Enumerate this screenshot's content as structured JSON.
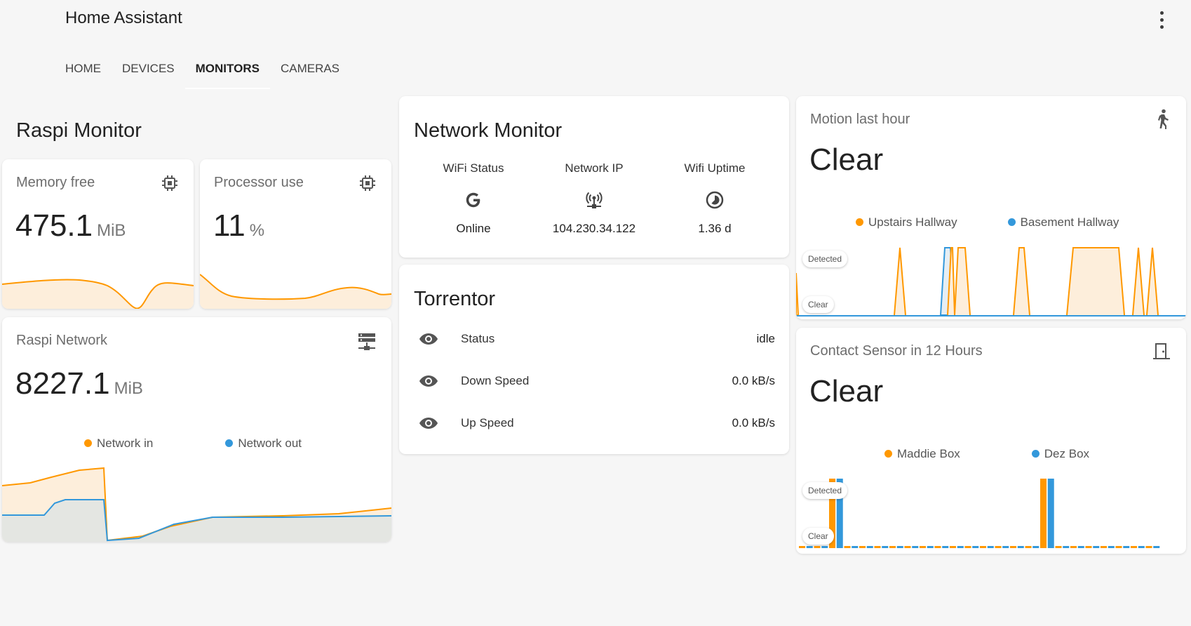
{
  "app": {
    "title": "Home Assistant"
  },
  "tabs": [
    {
      "label": "HOME"
    },
    {
      "label": "DEVICES"
    },
    {
      "label": "MONITORS"
    },
    {
      "label": "CAMERAS"
    }
  ],
  "raspi_monitor": {
    "title": "Raspi Monitor",
    "memory": {
      "name": "Memory free",
      "value": "475.1",
      "unit": "MiB",
      "icon": "chip-icon"
    },
    "processor": {
      "name": "Processor use",
      "value": "11",
      "unit": "%",
      "icon": "chip-icon"
    },
    "network": {
      "name": "Raspi Network",
      "value": "8227.1",
      "unit": "MiB",
      "icon": "server-network-icon",
      "legend": [
        "Network in",
        "Network out"
      ]
    }
  },
  "network_monitor": {
    "title": "Network Monitor",
    "columns": [
      {
        "label": "WiFi Status",
        "value": "Online",
        "icon": "google-icon"
      },
      {
        "label": "Network IP",
        "value": "104.230.34.122",
        "icon": "access-point-network-icon"
      },
      {
        "label": "Wifi Uptime",
        "value": "1.36 d",
        "icon": "timelapse-icon"
      }
    ]
  },
  "torrentor": {
    "title": "Torrentor",
    "rows": [
      {
        "label": "Status",
        "value": "idle"
      },
      {
        "label": "Down Speed",
        "value": "0.0 kB/s"
      },
      {
        "label": "Up Speed",
        "value": "0.0 kB/s"
      }
    ]
  },
  "motion": {
    "name": "Motion last hour",
    "state": "Clear",
    "icon": "walk-icon",
    "legend": [
      "Upstairs Hallway",
      "Basement Hallway"
    ],
    "axis_labels": [
      "Detected",
      "Clear"
    ]
  },
  "contact": {
    "name": "Contact Sensor in 12 Hours",
    "state": "Clear",
    "icon": "door-icon",
    "legend": [
      "Maddie Box",
      "Dez Box"
    ],
    "axis_labels": [
      "Detected",
      "Clear"
    ]
  },
  "colors": {
    "orange": "#ff9800",
    "blue": "#3398db",
    "orange_fill": "#fdeedb",
    "blue_fill": "#e6eef4"
  }
}
